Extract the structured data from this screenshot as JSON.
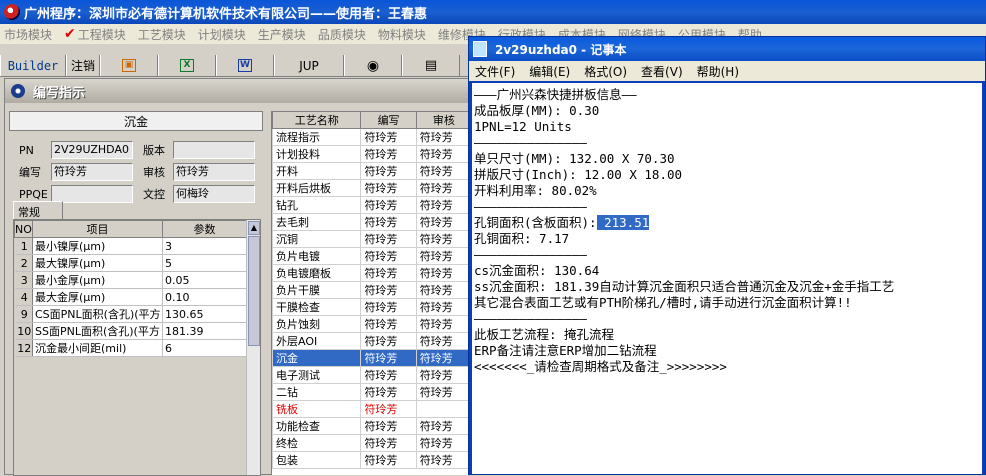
{
  "app": {
    "title": "广州程序：深圳市必有德计算机软件技术有限公司——使用者：王春惠"
  },
  "menubar": {
    "items": [
      "市场模块",
      "工程模块",
      "工艺模块",
      "计划模块",
      "生产模块",
      "品质模块",
      "物料模块",
      "维修模块",
      "行政模块",
      "成本模块",
      "网络模块",
      "公用模块",
      "帮助"
    ]
  },
  "toolbar": {
    "builder": "Builder",
    "logout": "注销",
    "jup": "JUP"
  },
  "panel": {
    "title": "编写指示",
    "process_name": "沉金",
    "labels": {
      "pn": "PN",
      "version": "版本",
      "writer": "编写",
      "reviewer": "审核",
      "ppqe": "PPQE",
      "doc_control": "文控"
    },
    "values": {
      "pn": "2V29UZHDA0",
      "version": "",
      "writer": "符玲芳",
      "reviewer": "符玲芳",
      "ppqe": "",
      "doc_control": "何梅玲"
    },
    "tab": "常规",
    "param_headers": [
      "NO",
      "项目",
      "参数"
    ],
    "params": [
      {
        "no": "1",
        "name": "最小镍厚(μm)",
        "value": "3"
      },
      {
        "no": "2",
        "name": "最大镍厚(μm)",
        "value": "5"
      },
      {
        "no": "3",
        "name": "最小金厚(μm)",
        "value": "0.05"
      },
      {
        "no": "4",
        "name": "最大金厚(μm)",
        "value": "0.10"
      },
      {
        "no": "9",
        "name": "CS面PNL面积(含孔)(平方",
        "value": "130.65"
      },
      {
        "no": "10",
        "name": "SS面PNL面积(含孔)(平方",
        "value": "181.39"
      },
      {
        "no": "12",
        "name": "沉金最小间距(mil)",
        "value": "6"
      }
    ]
  },
  "process_table": {
    "headers": [
      "工艺名称",
      "编写",
      "审核"
    ],
    "rows": [
      {
        "name": "流程指示",
        "writer": "符玲芳",
        "reviewer": "符玲芳"
      },
      {
        "name": "计划投料",
        "writer": "符玲芳",
        "reviewer": "符玲芳"
      },
      {
        "name": "开料",
        "writer": "符玲芳",
        "reviewer": "符玲芳"
      },
      {
        "name": "开料后烘板",
        "writer": "符玲芳",
        "reviewer": "符玲芳"
      },
      {
        "name": "钻孔",
        "writer": "符玲芳",
        "reviewer": "符玲芳"
      },
      {
        "name": "去毛刺",
        "writer": "符玲芳",
        "reviewer": "符玲芳"
      },
      {
        "name": "沉铜",
        "writer": "符玲芳",
        "reviewer": "符玲芳"
      },
      {
        "name": "负片电镀",
        "writer": "符玲芳",
        "reviewer": "符玲芳"
      },
      {
        "name": "负电镀磨板",
        "writer": "符玲芳",
        "reviewer": "符玲芳"
      },
      {
        "name": "负片干膜",
        "writer": "符玲芳",
        "reviewer": "符玲芳"
      },
      {
        "name": "干膜检查",
        "writer": "符玲芳",
        "reviewer": "符玲芳"
      },
      {
        "name": "负片蚀刻",
        "writer": "符玲芳",
        "reviewer": "符玲芳"
      },
      {
        "name": "外层AOI",
        "writer": "符玲芳",
        "reviewer": "符玲芳"
      },
      {
        "name": "沉金",
        "writer": "符玲芳",
        "reviewer": "符玲芳",
        "selected": true
      },
      {
        "name": "电子测试",
        "writer": "符玲芳",
        "reviewer": "符玲芳"
      },
      {
        "name": "二钻",
        "writer": "符玲芳",
        "reviewer": "符玲芳"
      },
      {
        "name": "铣板",
        "writer": "符玲芳",
        "reviewer": "",
        "red": true
      },
      {
        "name": "功能检查",
        "writer": "符玲芳",
        "reviewer": "符玲芳"
      },
      {
        "name": "终检",
        "writer": "符玲芳",
        "reviewer": "符玲芳"
      },
      {
        "name": "包装",
        "writer": "符玲芳",
        "reviewer": "符玲芳"
      }
    ]
  },
  "notepad": {
    "title": "2v29uzhda0 - 记事本",
    "menu": [
      "文件(F)",
      "编辑(E)",
      "格式(O)",
      "查看(V)",
      "帮助(H)"
    ],
    "lines": [
      "———广州兴森快捷拼板信息——",
      "成品板厚(MM): 0.30",
      "1PNL=12 Units",
      "———————————————",
      "单只尺寸(MM): 132.00 X 70.30",
      "拼版尺寸(Inch): 12.00 X 18.00",
      "开料利用率: 80.02%",
      "———————————————"
    ],
    "hole_label": "孔铜面积(含板面积):",
    "hole_value": " 213.51",
    "lines2": [
      "孔铜面积: 7.17",
      "———————————————",
      "cs沉金面积: 130.64",
      "ss沉金面积: 181.39自动计算沉金面积只适合普通沉金及沉金+金手指工艺",
      "其它混合表面工艺或有PTH阶梯孔/槽时,请手动进行沉金面积计算!!",
      "———————————————",
      "此板工艺流程: 掩孔流程",
      "ERP备注请注意ERP增加二钻流程",
      "<<<<<<<_请检查周期格式及备注_>>>>>>>>"
    ]
  }
}
